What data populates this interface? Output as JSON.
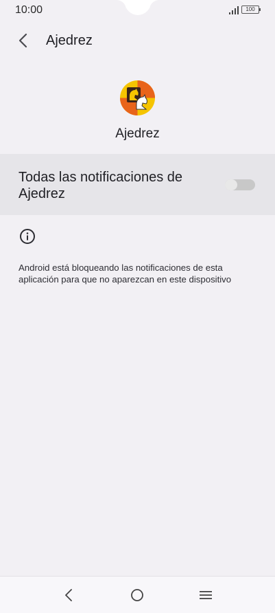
{
  "status_bar": {
    "time": "10:00",
    "battery": "100"
  },
  "app_bar": {
    "title": "Ajedrez"
  },
  "app": {
    "name": "Ajedrez",
    "icon": "chess-knight-icon"
  },
  "notifications_toggle": {
    "label": "Todas las notificaciones de Ajedrez",
    "enabled": false
  },
  "info": {
    "icon": "info-icon",
    "text": "Android está bloqueando las notificaciones de esta aplicación para que no aparezcan en este dispositivo"
  },
  "nav_bar": {
    "items": [
      "back-icon",
      "home-icon",
      "recents-icon"
    ]
  },
  "colors": {
    "background": "#f2f0f4",
    "row_highlight": "#e6e5e9",
    "toggle_off": "#c8c8c8",
    "icon_orange": "#e8641a",
    "icon_yellow": "#f5c400"
  }
}
